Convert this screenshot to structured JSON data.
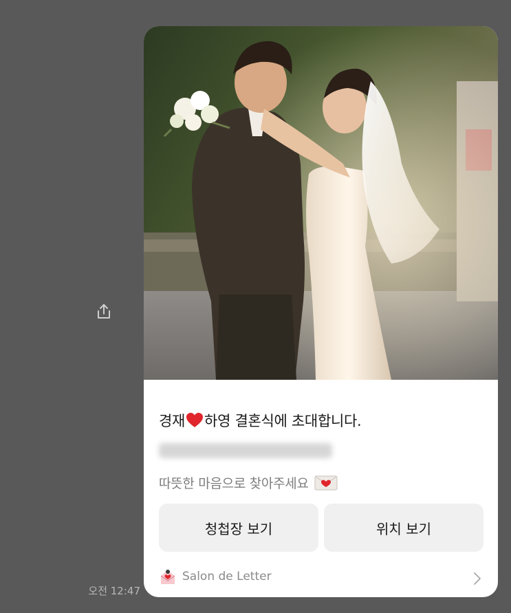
{
  "message": {
    "timestamp": "오전 12:47",
    "card": {
      "title_prefix": "경재",
      "title_emoji": "❤️",
      "title_suffix": "하영 결혼식에 초대합니다.",
      "subtitle": "따뜻한 마음으로 찾아주세요",
      "subtitle_emoji": "💌",
      "buttons": [
        {
          "label": "청첩장 보기"
        },
        {
          "label": "위치 보기"
        }
      ],
      "footer_label": "Salon de Letter"
    }
  },
  "colors": {
    "background": "#5a595a",
    "card": "#ffffff",
    "button": "#f0f0f0",
    "heart": "#e0262c"
  },
  "icons": {
    "share": "share-icon",
    "heart": "heart-emoji-icon",
    "envelope": "love-letter-icon",
    "logo": "salon-de-letter-logo-icon",
    "chevron": "chevron-right-icon"
  }
}
